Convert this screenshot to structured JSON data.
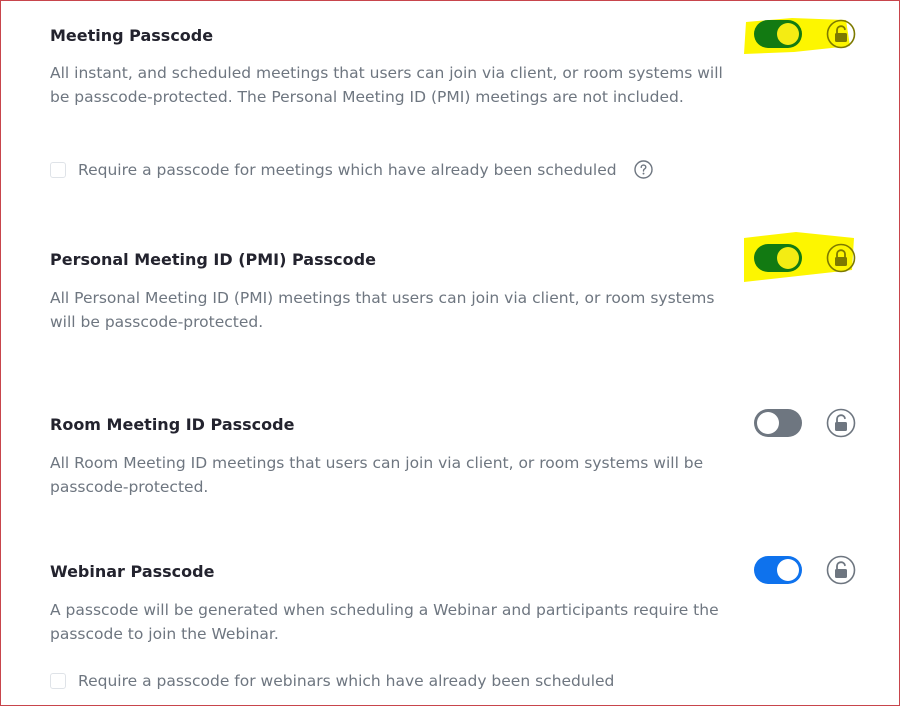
{
  "colors": {
    "toggle_on_green": "#127a12",
    "knob_yellow": "#f4ec13",
    "highlight": "#fdf600",
    "toggle_off": "#6e7680",
    "toggle_on_blue": "#0e72ed",
    "lock_default": "#6e7680",
    "lock_highlighted": "#7d7a00",
    "frame_border": "#c8454c"
  },
  "settings": {
    "meeting_passcode": {
      "title": "Meeting Passcode",
      "description": "All instant, and scheduled meetings that users can join via client, or room systems will be passcode-protected. The Personal Meeting ID (PMI) meetings are not included.",
      "toggle_on": true,
      "lock_icon": "unlock-icon",
      "checkbox_label": "Require a passcode for meetings which have already been scheduled",
      "help_icon": "question-circle-icon"
    },
    "pmi_passcode": {
      "title": "Personal Meeting ID (PMI) Passcode",
      "description": "All Personal Meeting ID (PMI) meetings that users can join via client, or room systems will be passcode-protected.",
      "toggle_on": true,
      "lock_icon": "lock-icon"
    },
    "room_passcode": {
      "title": "Room Meeting ID Passcode",
      "description": "All Room Meeting ID meetings that users can join via client, or room systems will be passcode-protected.",
      "toggle_on": false,
      "lock_icon": "unlock-icon"
    },
    "webinar_passcode": {
      "title": "Webinar Passcode",
      "description": "A passcode will be generated when scheduling a Webinar and participants require the passcode to join the Webinar.",
      "toggle_on": true,
      "lock_icon": "unlock-icon",
      "checkbox_label": "Require a passcode for webinars which have already been scheduled"
    }
  }
}
